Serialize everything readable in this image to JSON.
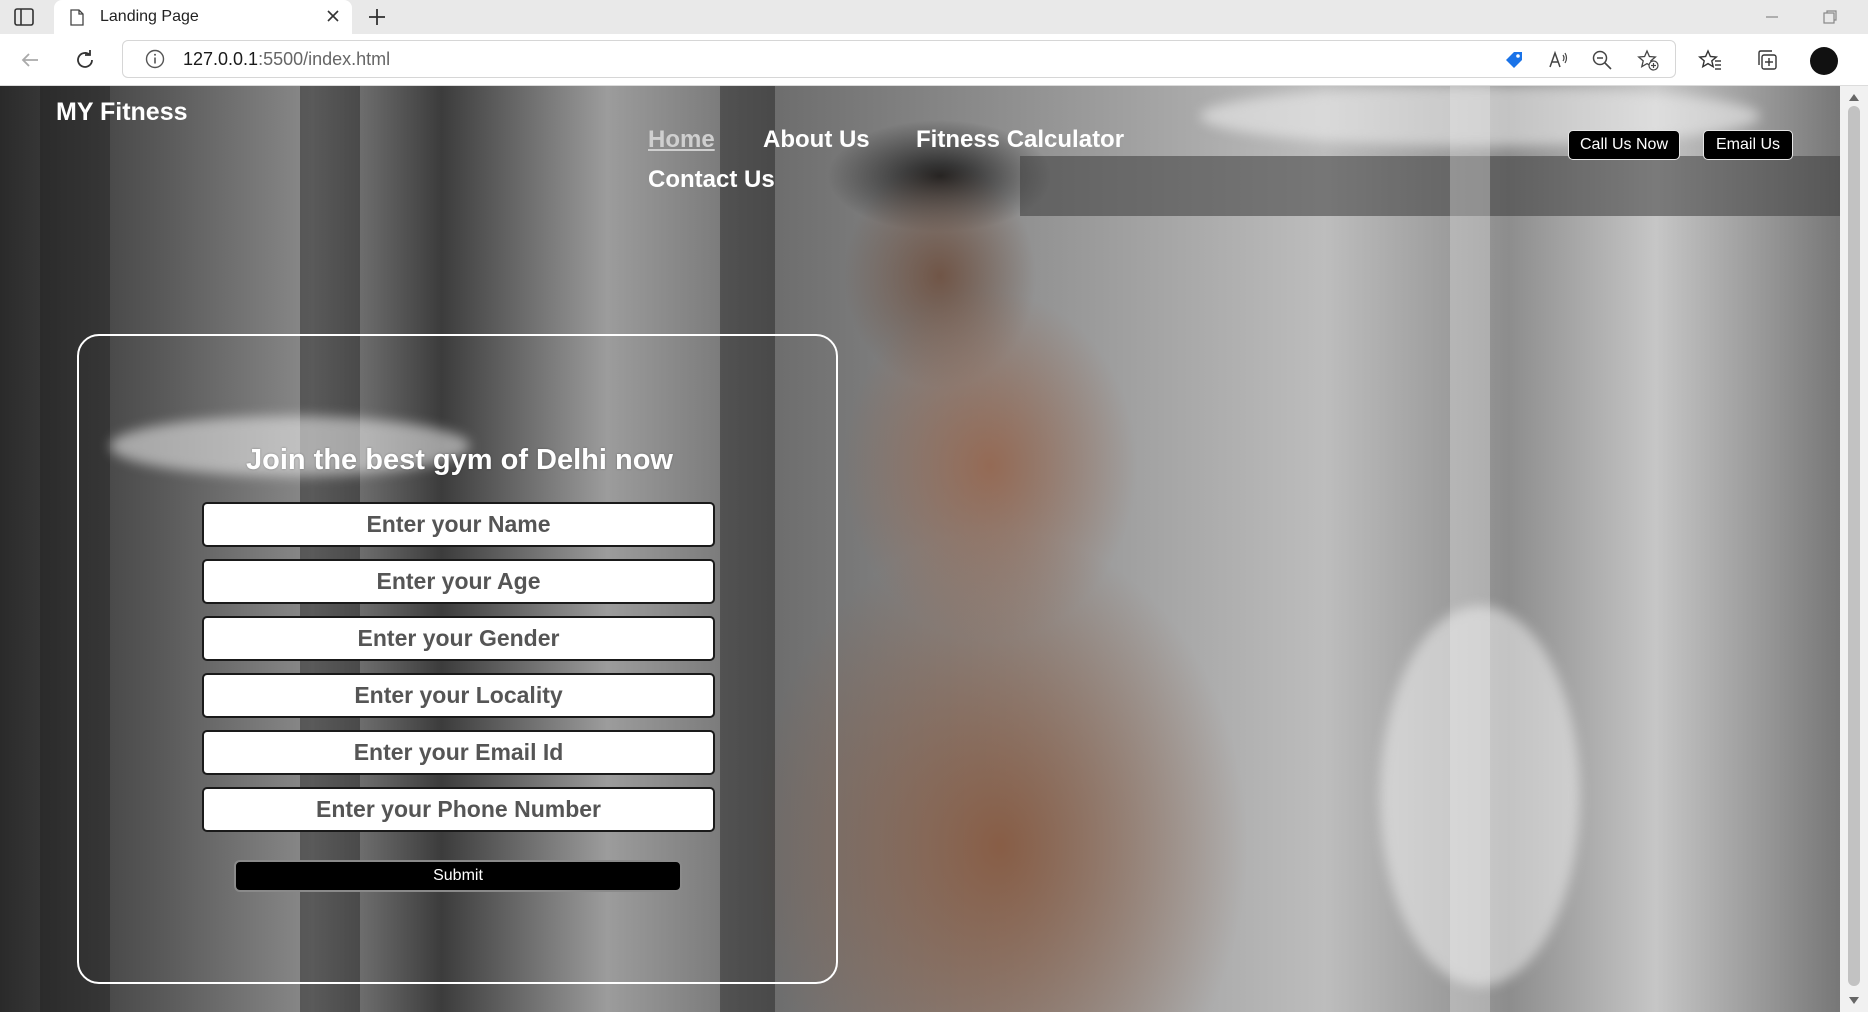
{
  "browser": {
    "tab_title": "Landing Page",
    "url_host": "127.0.0.1",
    "url_path": ":5500/index.html"
  },
  "site": {
    "brand": "MY Fitness",
    "nav": [
      {
        "label": "Home",
        "active": true
      },
      {
        "label": "About Us",
        "active": false
      },
      {
        "label": "Fitness Calculator",
        "active": false
      },
      {
        "label": "Contact Us",
        "active": false
      }
    ],
    "cta_call": "Call Us Now",
    "cta_email": "Email Us"
  },
  "form": {
    "heading": "Join the best gym of Delhi now",
    "fields": [
      {
        "placeholder": "Enter your Name",
        "value": ""
      },
      {
        "placeholder": "Enter your Age",
        "value": ""
      },
      {
        "placeholder": "Enter your Gender",
        "value": ""
      },
      {
        "placeholder": "Enter your Locality",
        "value": ""
      },
      {
        "placeholder": "Enter your Email Id",
        "value": ""
      },
      {
        "placeholder": "Enter your Phone Number",
        "value": ""
      }
    ],
    "submit_label": "Submit"
  },
  "icons": {
    "sidebar_toggle": "sidebar-icon",
    "page": "page-icon",
    "close": "close-icon",
    "new_tab": "plus-icon",
    "back": "back-arrow-icon",
    "refresh": "refresh-icon",
    "site_info": "info-icon",
    "coupon": "tag-icon",
    "read_aloud": "read-aloud-icon",
    "zoom": "zoom-out-icon",
    "add_favorite": "star-plus-icon",
    "favorites": "favorites-icon",
    "collections": "collections-icon"
  },
  "colors": {
    "accent_blue": "#1a73e8",
    "button_black": "#000000"
  }
}
